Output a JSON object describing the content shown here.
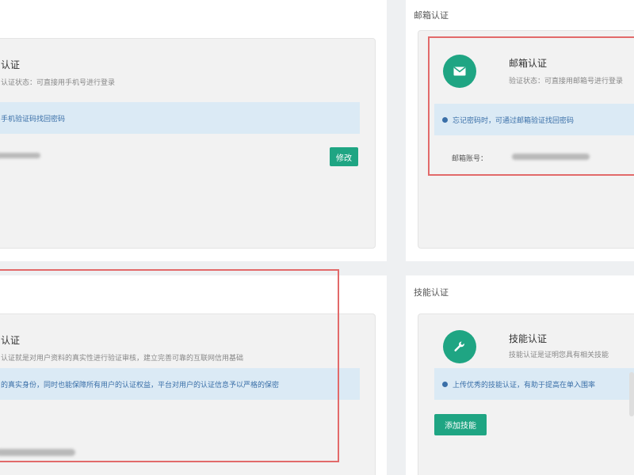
{
  "phone_card": {
    "title": "认证",
    "desc": "认证状态：可直接用手机号进行登录",
    "notice": "手机验证码找回密码",
    "button": "修改"
  },
  "email_panel": {
    "title": "邮箱认证",
    "card_title": "邮箱认证",
    "card_desc": "验证状态：可直接用邮箱号进行登录",
    "notice": "忘记密码时，可通过邮箱验证找回密码",
    "field_label": "邮箱账号："
  },
  "realname_card": {
    "title": "认证",
    "desc": "认证就是对用户资料的真实性进行验证审核，建立完善可靠的互联网信用基础",
    "notice": "的真实身份，同时也能保障所有用户的认证权益，平台对用户的认证信息予以严格的保密"
  },
  "skill_panel": {
    "title": "技能认证",
    "card_title": "技能认证",
    "card_desc": "技能认证是证明您具有相关技能",
    "notice": "上传优秀的技能认证，有助于提高在单入围率",
    "button": "添加技能"
  },
  "icons": {
    "email": "envelope-icon",
    "skill": "wrench-icon",
    "notice": "info-dot-icon"
  },
  "colors": {
    "accent": "#1fa583",
    "notice_bg": "#dbeaf5",
    "notice_text": "#3a6fa8",
    "highlight": "#e26a6a"
  }
}
